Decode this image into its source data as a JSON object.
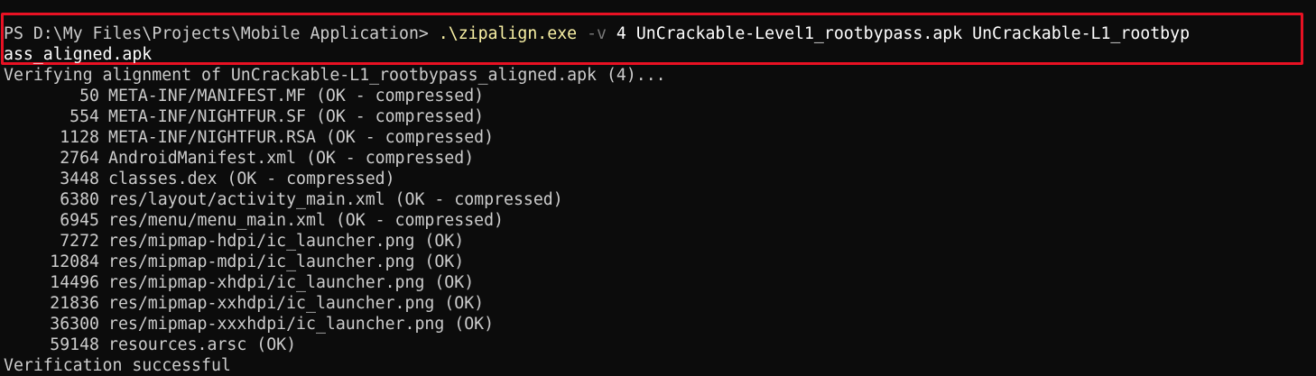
{
  "terminal": {
    "prompt": "PS D:\\My Files\\Projects\\Mobile Application> ",
    "command": {
      "exe": ".\\zipalign.exe",
      "flag": "-v",
      "alignment": "4",
      "input_apk": "UnCrackable-Level1_rootbypass.apk",
      "output_line1": "UnCrackable-L1_rootbyp",
      "output_line2": "ass_aligned.apk"
    },
    "verifying_line": "Verifying alignment of UnCrackable-L1_rootbypass_aligned.apk (4)...",
    "entries": [
      {
        "offset": "50",
        "text": "META-INF/MANIFEST.MF (OK - compressed)"
      },
      {
        "offset": "554",
        "text": "META-INF/NIGHTFUR.SF (OK - compressed)"
      },
      {
        "offset": "1128",
        "text": "META-INF/NIGHTFUR.RSA (OK - compressed)"
      },
      {
        "offset": "2764",
        "text": "AndroidManifest.xml (OK - compressed)"
      },
      {
        "offset": "3448",
        "text": "classes.dex (OK - compressed)"
      },
      {
        "offset": "6380",
        "text": "res/layout/activity_main.xml (OK - compressed)"
      },
      {
        "offset": "6945",
        "text": "res/menu/menu_main.xml (OK - compressed)"
      },
      {
        "offset": "7272",
        "text": "res/mipmap-hdpi/ic_launcher.png (OK)"
      },
      {
        "offset": "12084",
        "text": "res/mipmap-mdpi/ic_launcher.png (OK)"
      },
      {
        "offset": "14496",
        "text": "res/mipmap-xhdpi/ic_launcher.png (OK)"
      },
      {
        "offset": "21836",
        "text": "res/mipmap-xxhdpi/ic_launcher.png (OK)"
      },
      {
        "offset": "36300",
        "text": "res/mipmap-xxxhdpi/ic_launcher.png (OK)"
      },
      {
        "offset": "59148",
        "text": "resources.arsc (OK)"
      }
    ],
    "result_line": "Verification successful"
  },
  "colors": {
    "background": "#0c0c0c",
    "foreground": "#cccccc",
    "command": "#f9f1a5",
    "parameter": "#767676",
    "highlight_box": "#e81123"
  }
}
